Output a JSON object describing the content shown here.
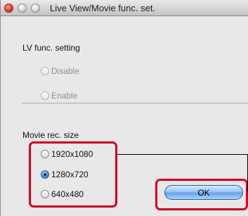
{
  "window": {
    "title": "Live View/Movie func. set."
  },
  "lv_func": {
    "label": "LV func. setting",
    "options": [
      {
        "label": "Disable",
        "enabled": false,
        "checked": false
      },
      {
        "label": "Enable",
        "enabled": false,
        "checked": false
      }
    ]
  },
  "movie_rec": {
    "label": "Movie rec. size",
    "options": [
      {
        "label": "1920x1080",
        "checked": false
      },
      {
        "label": "1280x720",
        "checked": true
      },
      {
        "label": "640x480",
        "checked": false
      }
    ]
  },
  "buttons": {
    "ok_label": "OK"
  },
  "colors": {
    "highlight": "#e0001b",
    "window_bg": "#e8e8e8",
    "ok_button": "#5f9fe8"
  }
}
